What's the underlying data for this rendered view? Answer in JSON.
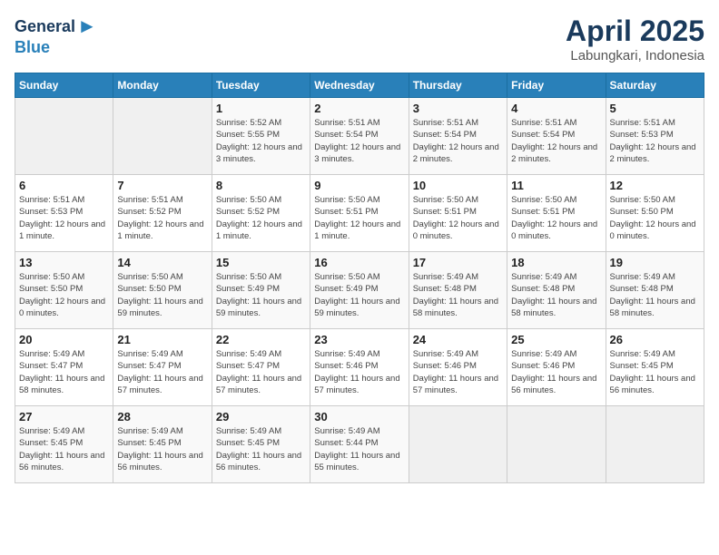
{
  "logo": {
    "general": "General",
    "blue": "Blue"
  },
  "header": {
    "month": "April 2025",
    "location": "Labungkari, Indonesia"
  },
  "weekdays": [
    "Sunday",
    "Monday",
    "Tuesday",
    "Wednesday",
    "Thursday",
    "Friday",
    "Saturday"
  ],
  "weeks": [
    [
      {
        "day": "",
        "sunrise": "",
        "sunset": "",
        "daylight": ""
      },
      {
        "day": "",
        "sunrise": "",
        "sunset": "",
        "daylight": ""
      },
      {
        "day": "1",
        "sunrise": "Sunrise: 5:52 AM",
        "sunset": "Sunset: 5:55 PM",
        "daylight": "Daylight: 12 hours and 3 minutes."
      },
      {
        "day": "2",
        "sunrise": "Sunrise: 5:51 AM",
        "sunset": "Sunset: 5:54 PM",
        "daylight": "Daylight: 12 hours and 3 minutes."
      },
      {
        "day": "3",
        "sunrise": "Sunrise: 5:51 AM",
        "sunset": "Sunset: 5:54 PM",
        "daylight": "Daylight: 12 hours and 2 minutes."
      },
      {
        "day": "4",
        "sunrise": "Sunrise: 5:51 AM",
        "sunset": "Sunset: 5:54 PM",
        "daylight": "Daylight: 12 hours and 2 minutes."
      },
      {
        "day": "5",
        "sunrise": "Sunrise: 5:51 AM",
        "sunset": "Sunset: 5:53 PM",
        "daylight": "Daylight: 12 hours and 2 minutes."
      }
    ],
    [
      {
        "day": "6",
        "sunrise": "Sunrise: 5:51 AM",
        "sunset": "Sunset: 5:53 PM",
        "daylight": "Daylight: 12 hours and 1 minute."
      },
      {
        "day": "7",
        "sunrise": "Sunrise: 5:51 AM",
        "sunset": "Sunset: 5:52 PM",
        "daylight": "Daylight: 12 hours and 1 minute."
      },
      {
        "day": "8",
        "sunrise": "Sunrise: 5:50 AM",
        "sunset": "Sunset: 5:52 PM",
        "daylight": "Daylight: 12 hours and 1 minute."
      },
      {
        "day": "9",
        "sunrise": "Sunrise: 5:50 AM",
        "sunset": "Sunset: 5:51 PM",
        "daylight": "Daylight: 12 hours and 1 minute."
      },
      {
        "day": "10",
        "sunrise": "Sunrise: 5:50 AM",
        "sunset": "Sunset: 5:51 PM",
        "daylight": "Daylight: 12 hours and 0 minutes."
      },
      {
        "day": "11",
        "sunrise": "Sunrise: 5:50 AM",
        "sunset": "Sunset: 5:51 PM",
        "daylight": "Daylight: 12 hours and 0 minutes."
      },
      {
        "day": "12",
        "sunrise": "Sunrise: 5:50 AM",
        "sunset": "Sunset: 5:50 PM",
        "daylight": "Daylight: 12 hours and 0 minutes."
      }
    ],
    [
      {
        "day": "13",
        "sunrise": "Sunrise: 5:50 AM",
        "sunset": "Sunset: 5:50 PM",
        "daylight": "Daylight: 12 hours and 0 minutes."
      },
      {
        "day": "14",
        "sunrise": "Sunrise: 5:50 AM",
        "sunset": "Sunset: 5:50 PM",
        "daylight": "Daylight: 11 hours and 59 minutes."
      },
      {
        "day": "15",
        "sunrise": "Sunrise: 5:50 AM",
        "sunset": "Sunset: 5:49 PM",
        "daylight": "Daylight: 11 hours and 59 minutes."
      },
      {
        "day": "16",
        "sunrise": "Sunrise: 5:50 AM",
        "sunset": "Sunset: 5:49 PM",
        "daylight": "Daylight: 11 hours and 59 minutes."
      },
      {
        "day": "17",
        "sunrise": "Sunrise: 5:49 AM",
        "sunset": "Sunset: 5:48 PM",
        "daylight": "Daylight: 11 hours and 58 minutes."
      },
      {
        "day": "18",
        "sunrise": "Sunrise: 5:49 AM",
        "sunset": "Sunset: 5:48 PM",
        "daylight": "Daylight: 11 hours and 58 minutes."
      },
      {
        "day": "19",
        "sunrise": "Sunrise: 5:49 AM",
        "sunset": "Sunset: 5:48 PM",
        "daylight": "Daylight: 11 hours and 58 minutes."
      }
    ],
    [
      {
        "day": "20",
        "sunrise": "Sunrise: 5:49 AM",
        "sunset": "Sunset: 5:47 PM",
        "daylight": "Daylight: 11 hours and 58 minutes."
      },
      {
        "day": "21",
        "sunrise": "Sunrise: 5:49 AM",
        "sunset": "Sunset: 5:47 PM",
        "daylight": "Daylight: 11 hours and 57 minutes."
      },
      {
        "day": "22",
        "sunrise": "Sunrise: 5:49 AM",
        "sunset": "Sunset: 5:47 PM",
        "daylight": "Daylight: 11 hours and 57 minutes."
      },
      {
        "day": "23",
        "sunrise": "Sunrise: 5:49 AM",
        "sunset": "Sunset: 5:46 PM",
        "daylight": "Daylight: 11 hours and 57 minutes."
      },
      {
        "day": "24",
        "sunrise": "Sunrise: 5:49 AM",
        "sunset": "Sunset: 5:46 PM",
        "daylight": "Daylight: 11 hours and 57 minutes."
      },
      {
        "day": "25",
        "sunrise": "Sunrise: 5:49 AM",
        "sunset": "Sunset: 5:46 PM",
        "daylight": "Daylight: 11 hours and 56 minutes."
      },
      {
        "day": "26",
        "sunrise": "Sunrise: 5:49 AM",
        "sunset": "Sunset: 5:45 PM",
        "daylight": "Daylight: 11 hours and 56 minutes."
      }
    ],
    [
      {
        "day": "27",
        "sunrise": "Sunrise: 5:49 AM",
        "sunset": "Sunset: 5:45 PM",
        "daylight": "Daylight: 11 hours and 56 minutes."
      },
      {
        "day": "28",
        "sunrise": "Sunrise: 5:49 AM",
        "sunset": "Sunset: 5:45 PM",
        "daylight": "Daylight: 11 hours and 56 minutes."
      },
      {
        "day": "29",
        "sunrise": "Sunrise: 5:49 AM",
        "sunset": "Sunset: 5:45 PM",
        "daylight": "Daylight: 11 hours and 56 minutes."
      },
      {
        "day": "30",
        "sunrise": "Sunrise: 5:49 AM",
        "sunset": "Sunset: 5:44 PM",
        "daylight": "Daylight: 11 hours and 55 minutes."
      },
      {
        "day": "",
        "sunrise": "",
        "sunset": "",
        "daylight": ""
      },
      {
        "day": "",
        "sunrise": "",
        "sunset": "",
        "daylight": ""
      },
      {
        "day": "",
        "sunrise": "",
        "sunset": "",
        "daylight": ""
      }
    ]
  ]
}
